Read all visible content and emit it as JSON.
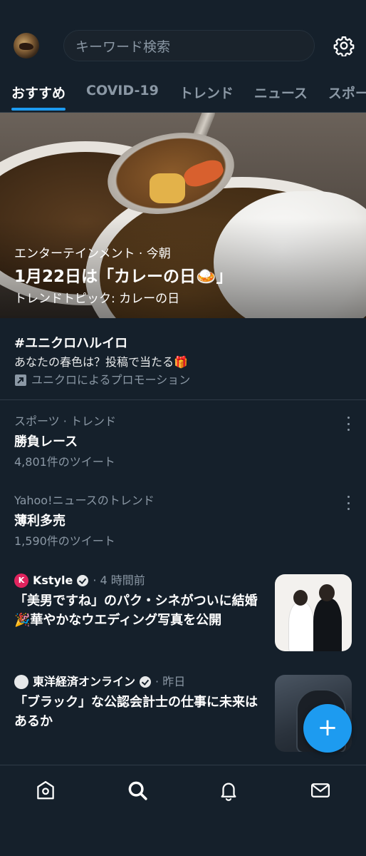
{
  "search": {
    "placeholder": "キーワード検索"
  },
  "tabs": [
    {
      "label": "おすすめ",
      "active": true
    },
    {
      "label": "COVID-19",
      "active": false
    },
    {
      "label": "トレンド",
      "active": false
    },
    {
      "label": "ニュース",
      "active": false
    },
    {
      "label": "スポー",
      "active": false
    }
  ],
  "hero": {
    "category": "エンターテインメント · 今朝",
    "title": "1月22日は「カレーの日🍛」",
    "subtitle": "トレンドトピック: カレーの日"
  },
  "promoted": {
    "hashtag": "#ユニクロハルイロ",
    "description": "あなたの春色は？投稿で当たる🎁",
    "promo_label": "ユニクロによるプロモーション"
  },
  "trends": [
    {
      "category": "スポーツ · トレンド",
      "title": "勝負レース",
      "count": "4,801件のツイート"
    },
    {
      "category": "Yahoo!ニュースのトレンド",
      "title": "薄利多売",
      "count": "1,590件のツイート"
    }
  ],
  "news": [
    {
      "source": "Kstyle",
      "logo_letter": "K",
      "time": "· 4 時間前",
      "title": "「美男ですね」のパク・シネがついに結婚🎉華やかなウエディング写真を公開"
    },
    {
      "source": "東洋経済オンライン",
      "logo_letter": "",
      "time": "· 昨日",
      "title": "「ブラック」な公認会計士の仕事に未来はあるか"
    }
  ],
  "fab": {
    "label": "+"
  },
  "colors": {
    "background": "#15202b",
    "accent": "#1d9bf0",
    "secondary_text": "#8b98a5"
  },
  "icons": [
    "avatar",
    "gear-icon",
    "home-icon",
    "search-icon",
    "bell-icon",
    "mail-icon",
    "more-icon",
    "verified-icon",
    "promo-arrow-icon"
  ]
}
